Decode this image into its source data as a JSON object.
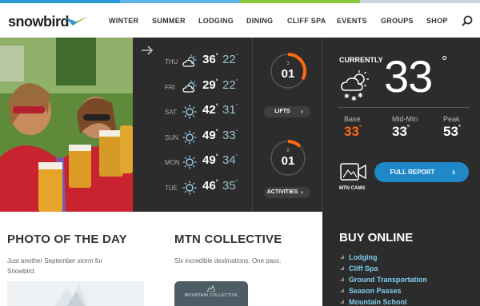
{
  "colors": {
    "stripe": [
      "#2b95d6",
      "#5cb7e6",
      "#8fc93a",
      "#c7d6df"
    ],
    "accent_blue": "#1e88c8",
    "accent_orange": "#ff6a13",
    "link_blue": "#7fd0f0",
    "panel_dark": "#2c2c2c"
  },
  "header": {
    "logo_text": "snowbird",
    "logo_icon": "snowbird-wing-logo",
    "nav": [
      "WINTER",
      "SUMMER",
      "LODGING",
      "DINING",
      "CLIFF SPA",
      "EVENTS",
      "GROUPS",
      "SHOP"
    ],
    "search_icon": "search-icon"
  },
  "forecast": [
    {
      "day": "THU",
      "icon": "partly-sunny-icon",
      "hi": "36",
      "lo": "22"
    },
    {
      "day": "FRI",
      "icon": "partly-sunny-icon",
      "hi": "29",
      "lo": "22"
    },
    {
      "day": "SAT",
      "icon": "sunny-icon",
      "hi": "42",
      "lo": "31"
    },
    {
      "day": "SUN",
      "icon": "sunny-icon",
      "hi": "49",
      "lo": "33"
    },
    {
      "day": "MON",
      "icon": "sunny-icon",
      "hi": "49",
      "lo": "34"
    },
    {
      "day": "TUE",
      "icon": "sunny-icon",
      "hi": "46",
      "lo": "35"
    }
  ],
  "deg_symbol": "°",
  "gauges": {
    "lifts": {
      "small": "3",
      "value": "01",
      "label": "LIFTS",
      "fraction": 0.33
    },
    "activities": {
      "small": "8",
      "value": "01",
      "label": "ACTIVITIES",
      "fraction": 0.125
    }
  },
  "current": {
    "label": "CURRENTLY",
    "icon": "snow-sun-icon",
    "temp": "33",
    "deg": "°",
    "stats": [
      {
        "name": "Base",
        "value": "33",
        "highlight": true
      },
      {
        "name": "Mid-Mtn",
        "value": "33",
        "highlight": false
      },
      {
        "name": "Peak",
        "value": "53",
        "highlight": false
      }
    ],
    "cams_label": "MTN CAMS",
    "report_button": "FULL REPORT"
  },
  "photo_of_day": {
    "title": "PHOTO OF THE DAY",
    "text": "Just another September storm for Snowbird."
  },
  "mtn_collective": {
    "title": "MTN COLLECTIVE",
    "text": "Six incredible destinations. One pass.",
    "thumb_text": "MOUNTAIN COLLECTIVE"
  },
  "buy_online": {
    "title": "BUY ONLINE",
    "items": [
      "Lodging",
      "Cliff Spa",
      "Ground Transportation",
      "Season Passes",
      "Mountain School"
    ]
  },
  "chevron": "›"
}
